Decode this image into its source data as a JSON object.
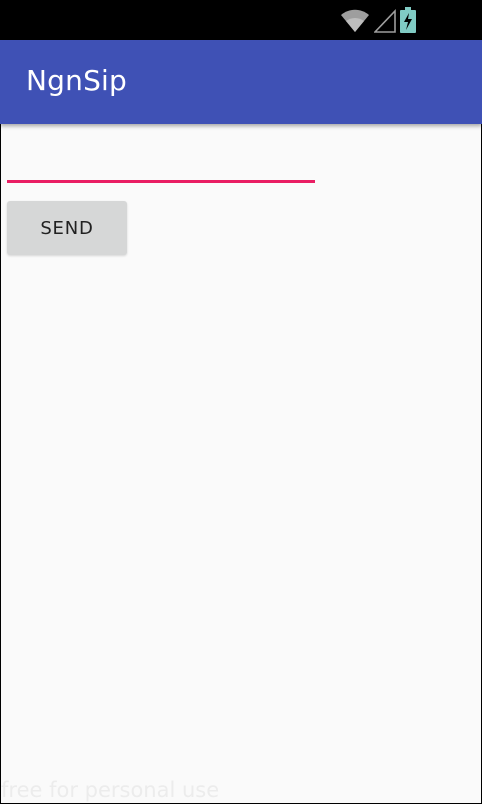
{
  "status_bar": {
    "icons": [
      "wifi-icon",
      "cell-signal-icon",
      "battery-charging-icon"
    ],
    "background": "#000000",
    "battery_color": "#80CBC4"
  },
  "app_bar": {
    "title": "NgnSip",
    "color": "#3F51B5"
  },
  "form": {
    "message_value": "",
    "message_placeholder": "",
    "send_label": "SEND",
    "accent_color": "#E91E63"
  },
  "watermark": {
    "text": "free for personal use"
  }
}
